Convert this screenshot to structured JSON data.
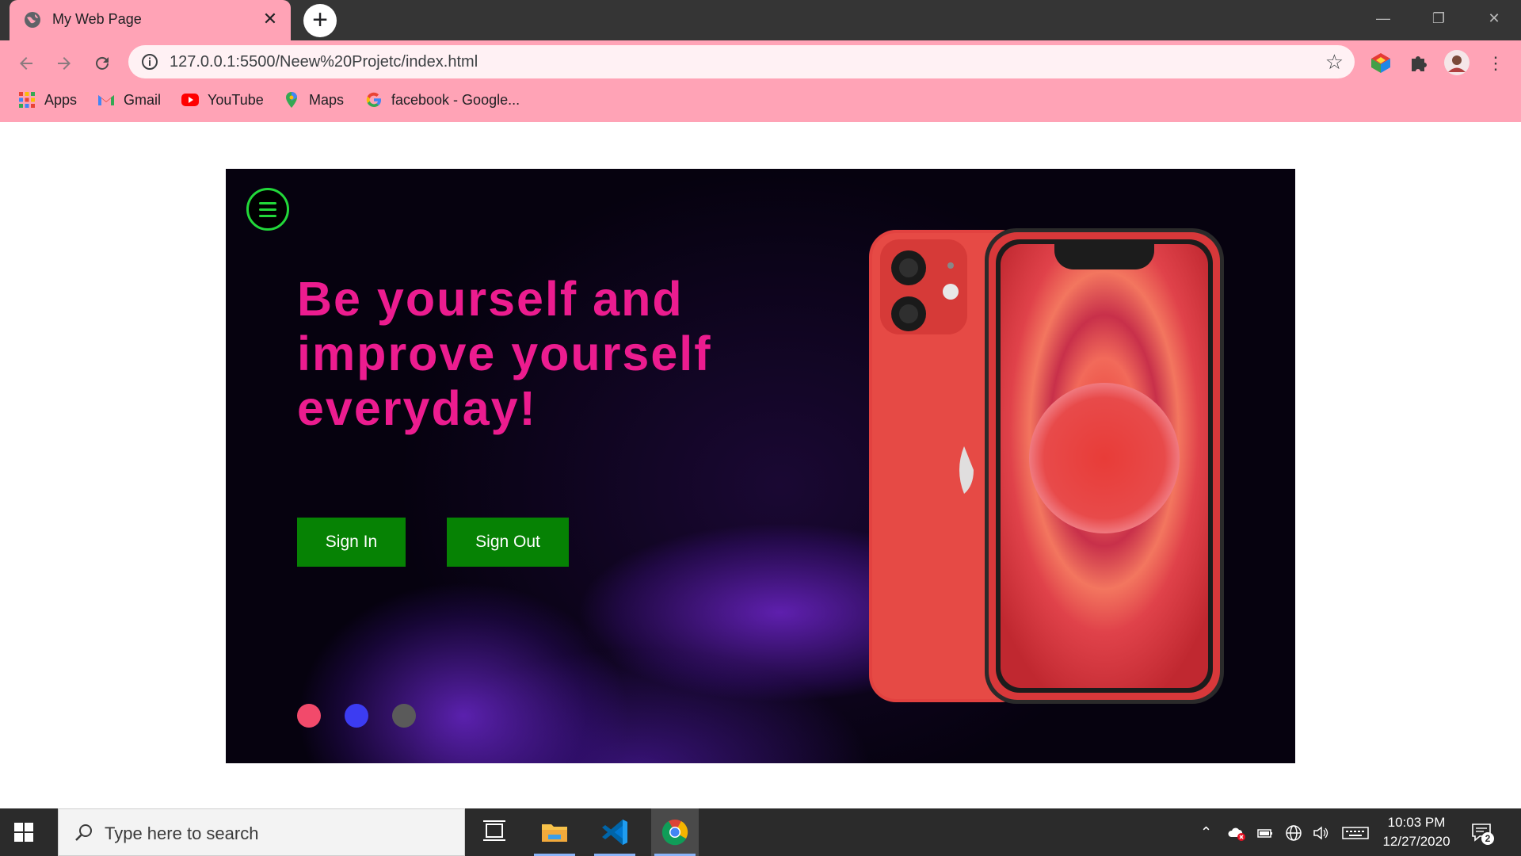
{
  "browser": {
    "tab": {
      "title": "My Web Page",
      "close_glyph": "✕"
    },
    "new_tab_glyph": "+",
    "address": {
      "url": "127.0.0.1:5500/Neew%20Projetc/index.html"
    },
    "bookmarks": [
      {
        "label": "Apps",
        "icon": "apps-grid-icon"
      },
      {
        "label": "Gmail",
        "icon": "gmail-icon"
      },
      {
        "label": "YouTube",
        "icon": "youtube-icon"
      },
      {
        "label": "Maps",
        "icon": "maps-icon"
      },
      {
        "label": "facebook - Google...",
        "icon": "google-icon"
      }
    ],
    "colors": {
      "chrome_pink": "#ffa3b6",
      "tab_strip": "#353535"
    }
  },
  "page": {
    "headline": "Be yourself and improve yourself everyday!",
    "buttons": {
      "sign_in": "Sign In",
      "sign_out": "Sign Out"
    },
    "dots": [
      {
        "color": "#f24a6b"
      },
      {
        "color": "#3c3cf2"
      },
      {
        "color": "#5a5a5a"
      }
    ],
    "colors": {
      "headline": "#ec1c8f",
      "button": "#068204",
      "menu_ring": "#22d93a"
    }
  },
  "taskbar": {
    "search_placeholder": "Type here to search",
    "time": "10:03 PM",
    "date": "12/27/2020",
    "notification_count": "2"
  }
}
